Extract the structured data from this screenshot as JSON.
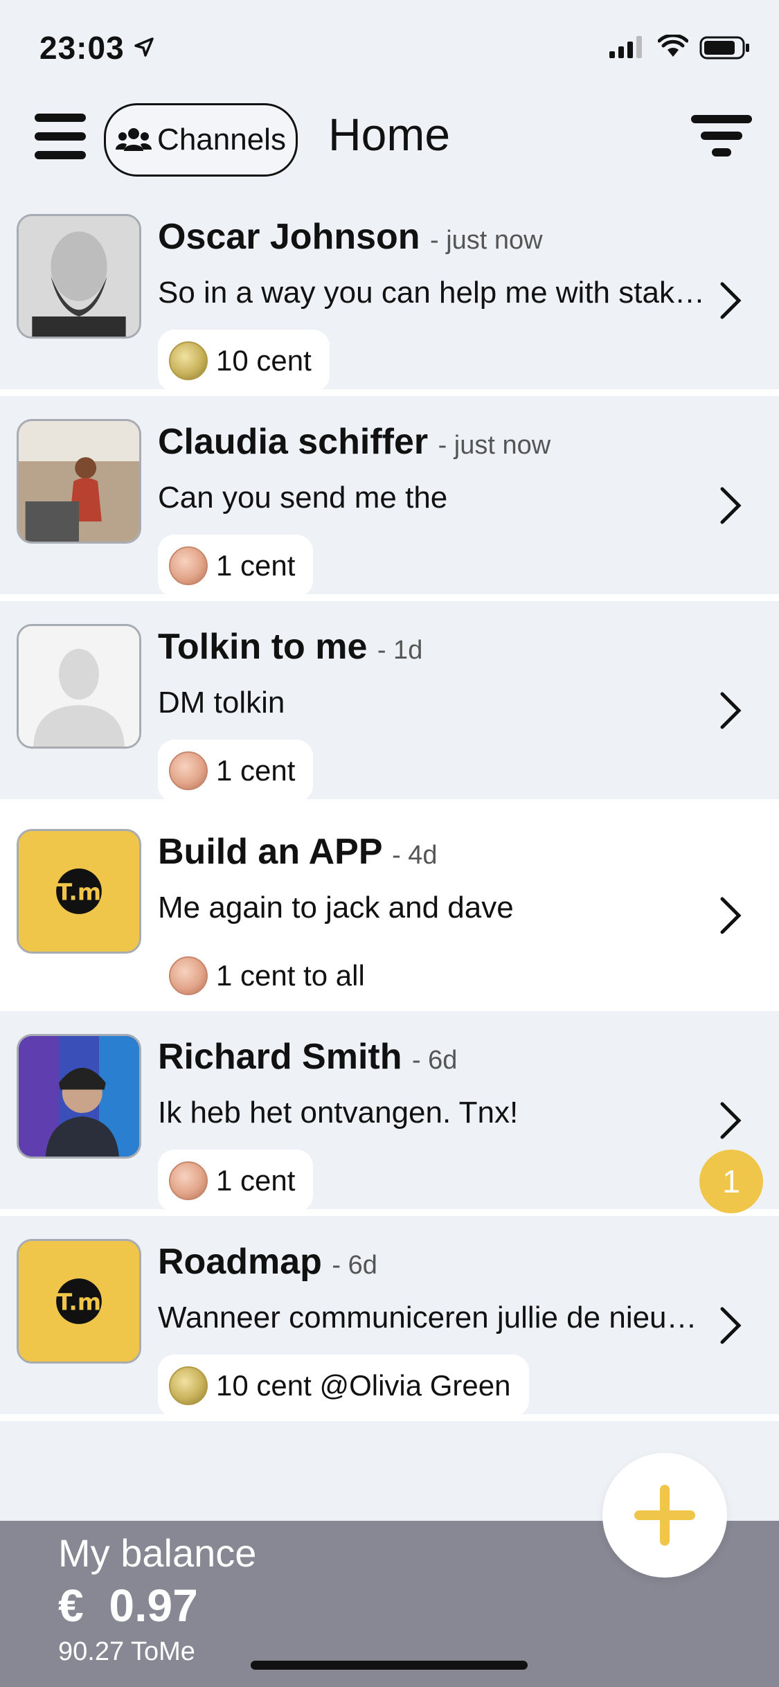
{
  "status_bar": {
    "time": "23:03"
  },
  "header": {
    "channels_label": "Channels",
    "title": "Home"
  },
  "conversations": [
    {
      "name": "Oscar Johnson",
      "time": "- just now",
      "message": "So in a way you can help me with stake…",
      "tip": "10 cent",
      "coin": "gold",
      "avatar": "photo-bald-bearded-man"
    },
    {
      "name": "Claudia schiffer",
      "time": "- just now",
      "message": "Can you send me the",
      "tip": "1 cent",
      "coin": "copper",
      "avatar": "photo-woman-at-counter"
    },
    {
      "name": "Tolkin to me",
      "time": "- 1d",
      "message": "DM tolkin",
      "tip": "1 cent",
      "coin": "copper",
      "avatar": "placeholder-person"
    },
    {
      "name": "Build an APP",
      "time": "- 4d",
      "message": "Me again to jack and dave",
      "tip": "1 cent to all",
      "coin": "copper",
      "avatar": "tome-logo"
    },
    {
      "name": "Richard Smith",
      "time": "- 6d",
      "message": "Ik heb het ontvangen. Tnx!",
      "tip": "1 cent",
      "coin": "copper",
      "avatar": "photo-man-neon",
      "unread": "1"
    },
    {
      "name": "Roadmap",
      "time": "- 6d",
      "message": "Wanneer communiceren jullie de nieu…",
      "tip": "10 cent @Olivia Green",
      "coin": "gold",
      "avatar": "tome-logo"
    }
  ],
  "footer": {
    "balance_label": "My balance",
    "balance_value": "€  0.97",
    "tome_value": "90.27 ToMe"
  },
  "colors": {
    "accent": "#f0c64a",
    "footer_bg": "#878893",
    "list_bg": "#eef1f6"
  }
}
